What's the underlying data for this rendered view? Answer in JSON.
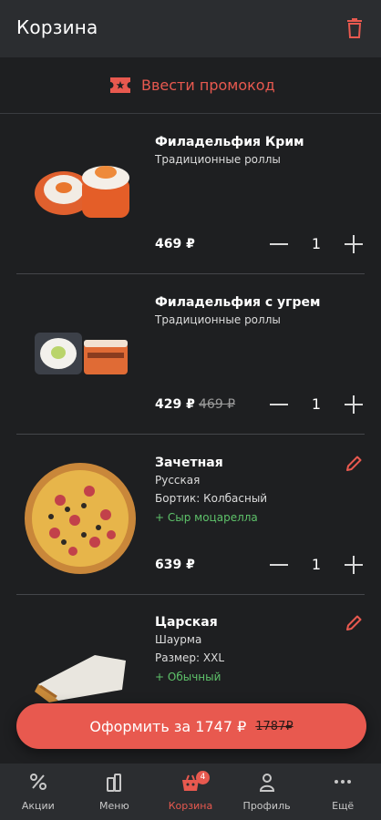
{
  "header": {
    "title": "Корзина",
    "trash_icon": "trash-icon"
  },
  "promo": {
    "label": "Ввести промокод",
    "icon": "ticket-icon"
  },
  "items": [
    {
      "name": "Филадельфия Крим",
      "category": "Традиционные роллы",
      "price": "469 ₽",
      "quantity": "1"
    },
    {
      "name": "Филадельфия с угрем",
      "category": "Традиционные роллы",
      "price": "429 ₽",
      "old_price": "469 ₽",
      "quantity": "1"
    },
    {
      "name": "Зачетная",
      "category": "Русская",
      "detail": "Бортик: Колбасный",
      "addon": "+ Сыр моцарелла",
      "price": "639 ₽",
      "quantity": "1"
    },
    {
      "name": "Царская",
      "category": "Шаурма",
      "detail": "Размер: XXL",
      "addon": "+ Обычный"
    }
  ],
  "checkout": {
    "label": "Оформить за 1747 ₽",
    "old_total": "1787₽"
  },
  "tabs": [
    {
      "label": "Акции",
      "icon": "percent-icon"
    },
    {
      "label": "Меню",
      "icon": "drinks-icon"
    },
    {
      "label": "Корзина",
      "icon": "cart-icon",
      "badge": "4",
      "active": true
    },
    {
      "label": "Профиль",
      "icon": "profile-icon"
    },
    {
      "label": "Ещё",
      "icon": "more-icon"
    }
  ],
  "colors": {
    "accent": "#e8594f",
    "background": "#1e1f21",
    "panel": "#2b2d30",
    "addon": "#5ec26a"
  }
}
